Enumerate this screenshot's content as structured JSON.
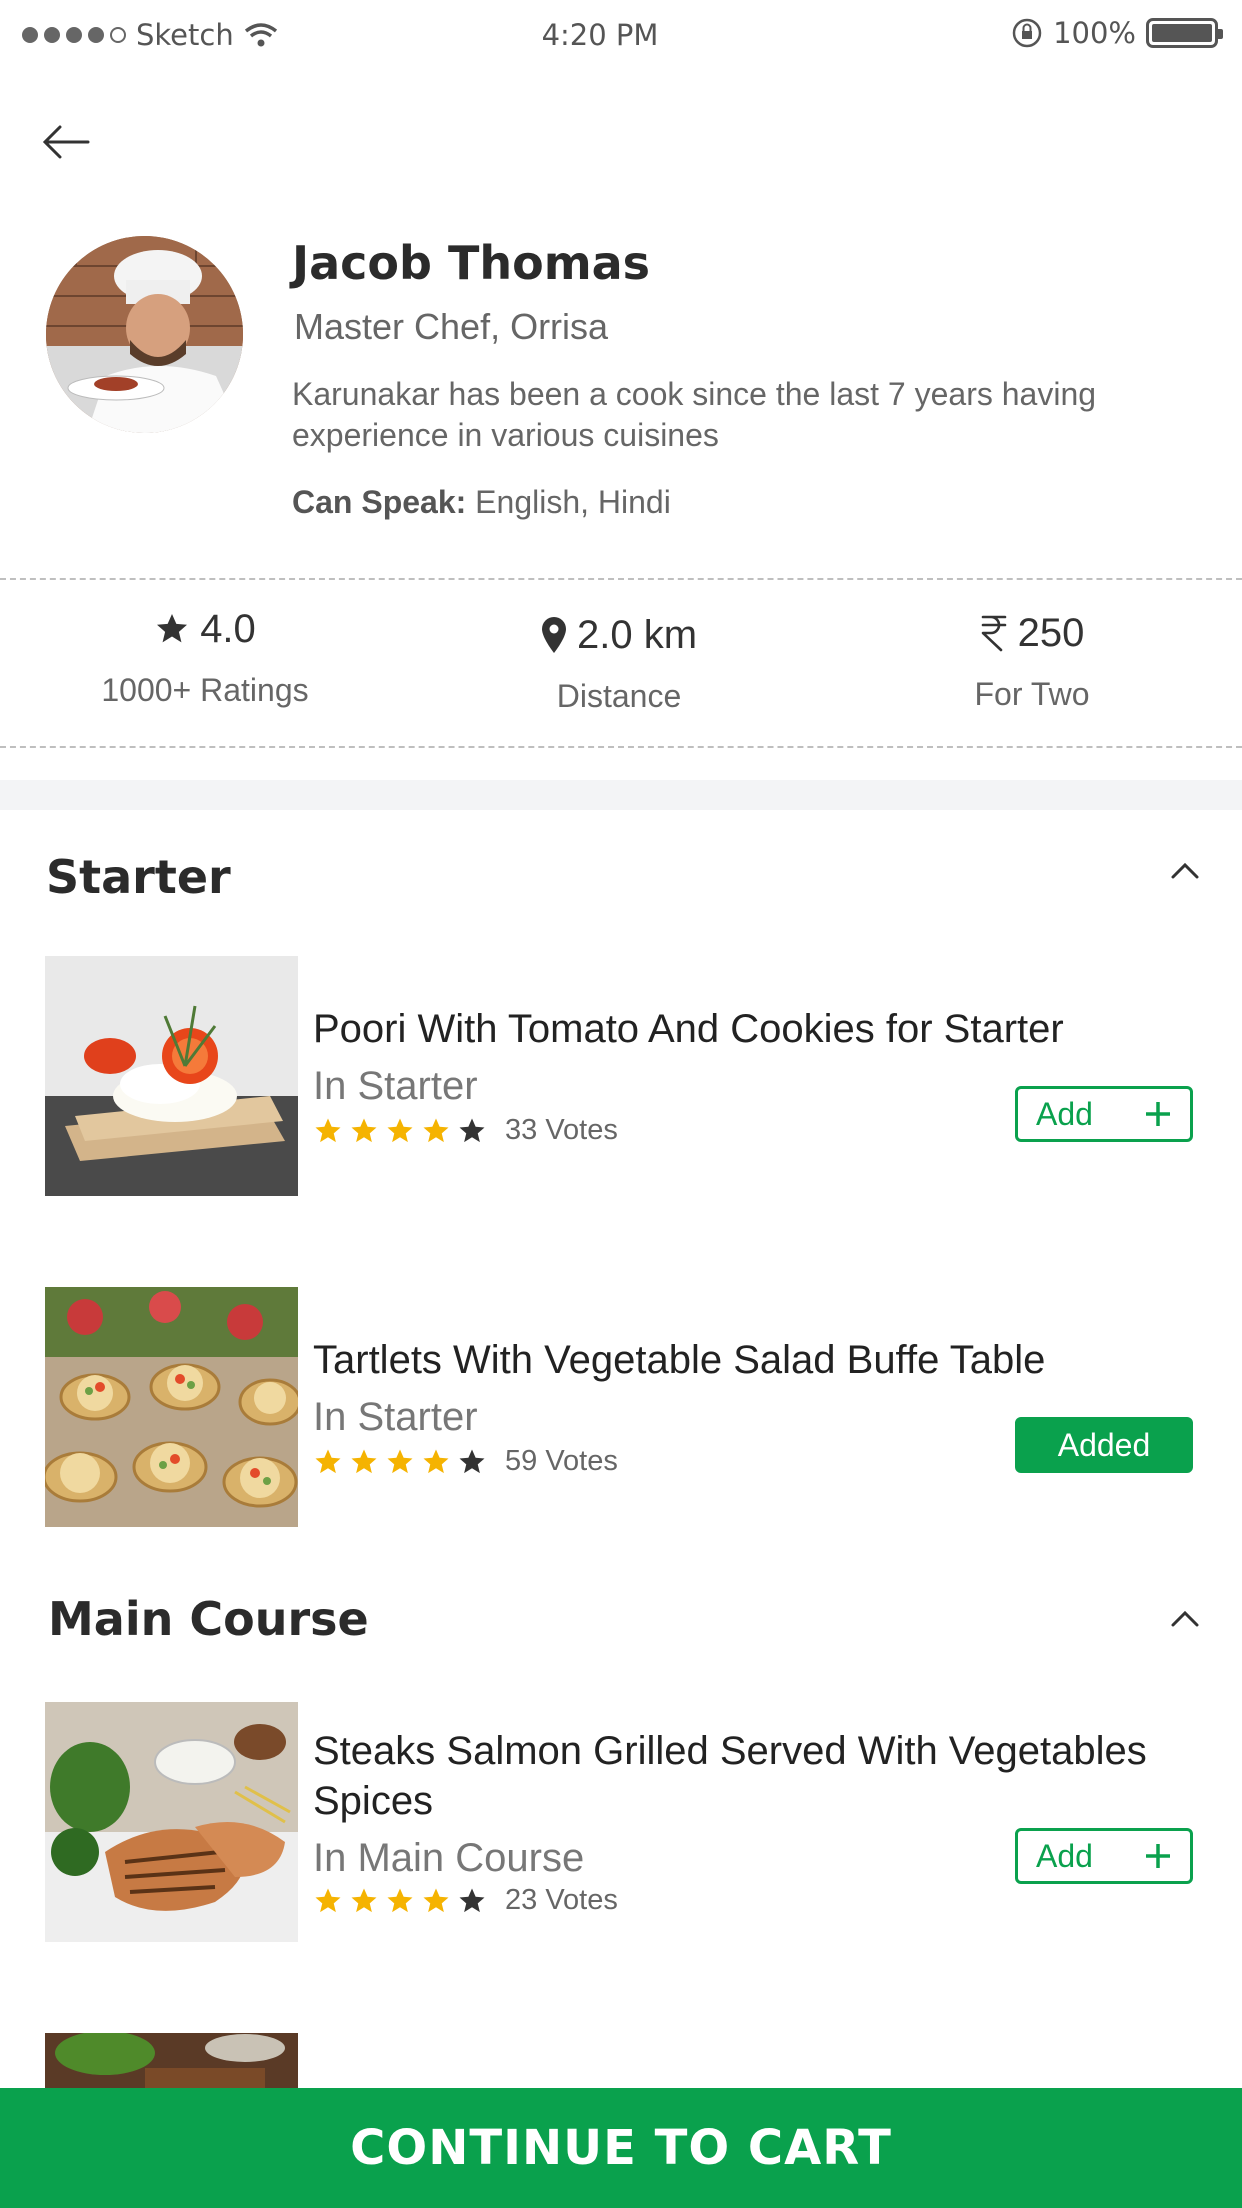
{
  "status_bar": {
    "carrier": "Sketch",
    "time": "4:20 PM",
    "battery": "100%"
  },
  "chef": {
    "name": "Jacob Thomas",
    "title": "Master Chef, Orrisa",
    "bio": "Karunakar has been a cook since the last 7 years having experience in various cuisines",
    "speak_label": "Can Speak:",
    "speak_value": " English, Hindi"
  },
  "stats": [
    {
      "value": "4.0",
      "label": "1000+ Ratings",
      "icon": "star-icon"
    },
    {
      "value": "2.0 km",
      "label": "Distance",
      "icon": "location-pin-icon"
    },
    {
      "value": "250",
      "label": "For Two",
      "icon": "rupee-icon"
    }
  ],
  "sections": [
    {
      "title": "Starter",
      "items": [
        {
          "name": "Poori With Tomato And Cookies for Starter",
          "category": "In Starter",
          "rating": 4,
          "votes": "33 Votes",
          "action": "Add",
          "state": "add"
        },
        {
          "name": "Tartlets With Vegetable Salad Buffe Table",
          "category": "In Starter",
          "rating": 4,
          "votes": "59 Votes",
          "action": "Added",
          "state": "added"
        }
      ]
    },
    {
      "title": "Main Course",
      "items": [
        {
          "name": "Steaks Salmon Grilled Served With Vegetables Spices",
          "category": "In Main Course",
          "rating": 4,
          "votes": "23 Votes",
          "action": "Add",
          "state": "add"
        }
      ]
    }
  ],
  "cta": {
    "label": "CONTINUE TO CART"
  },
  "colors": {
    "accent": "#0aa14d",
    "star": "#f5b301"
  }
}
